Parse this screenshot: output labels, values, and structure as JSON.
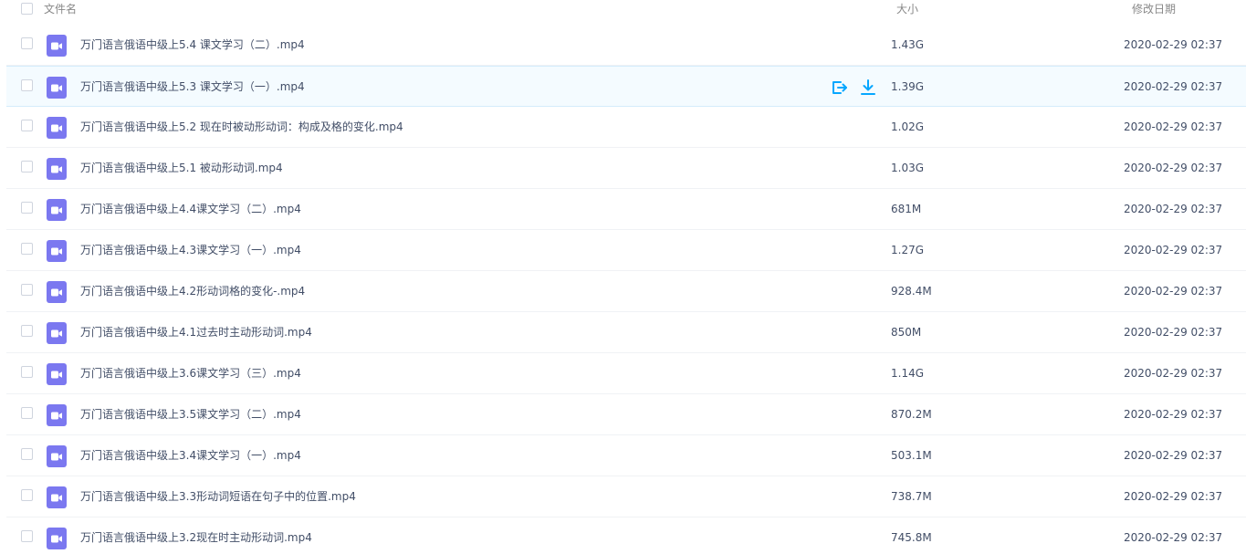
{
  "header": {
    "name_label": "文件名",
    "size_label": "大小",
    "date_label": "修改日期"
  },
  "colors": {
    "video_icon": "#7b78f0",
    "action_icon": "#06a7ff",
    "hover_row": "#f4fbff"
  },
  "hovered_row_actions": [
    "share-icon",
    "download-icon"
  ],
  "files": [
    {
      "name": "万门语言俄语中级上5.4 课文学习（二）.mp4",
      "size": "1.43G",
      "date": "2020-02-29 02:37"
    },
    {
      "name": "万门语言俄语中级上5.3 课文学习（一）.mp4",
      "size": "1.39G",
      "date": "2020-02-29 02:37"
    },
    {
      "name": "万门语言俄语中级上5.2 现在时被动形动词：构成及格的变化.mp4",
      "size": "1.02G",
      "date": "2020-02-29 02:37"
    },
    {
      "name": "万门语言俄语中级上5.1 被动形动词.mp4",
      "size": "1.03G",
      "date": "2020-02-29 02:37"
    },
    {
      "name": "万门语言俄语中级上4.4课文学习（二）.mp4",
      "size": "681M",
      "date": "2020-02-29 02:37"
    },
    {
      "name": "万门语言俄语中级上4.3课文学习（一）.mp4",
      "size": "1.27G",
      "date": "2020-02-29 02:37"
    },
    {
      "name": "万门语言俄语中级上4.2形动词格的变化-.mp4",
      "size": "928.4M",
      "date": "2020-02-29 02:37"
    },
    {
      "name": "万门语言俄语中级上4.1过去时主动形动词.mp4",
      "size": "850M",
      "date": "2020-02-29 02:37"
    },
    {
      "name": "万门语言俄语中级上3.6课文学习（三）.mp4",
      "size": "1.14G",
      "date": "2020-02-29 02:37"
    },
    {
      "name": "万门语言俄语中级上3.5课文学习（二）.mp4",
      "size": "870.2M",
      "date": "2020-02-29 02:37"
    },
    {
      "name": "万门语言俄语中级上3.4课文学习（一）.mp4",
      "size": "503.1M",
      "date": "2020-02-29 02:37"
    },
    {
      "name": "万门语言俄语中级上3.3形动词短语在句子中的位置.mp4",
      "size": "738.7M",
      "date": "2020-02-29 02:37"
    },
    {
      "name": "万门语言俄语中级上3.2现在时主动形动词.mp4",
      "size": "745.8M",
      "date": "2020-02-29 02:37"
    }
  ]
}
